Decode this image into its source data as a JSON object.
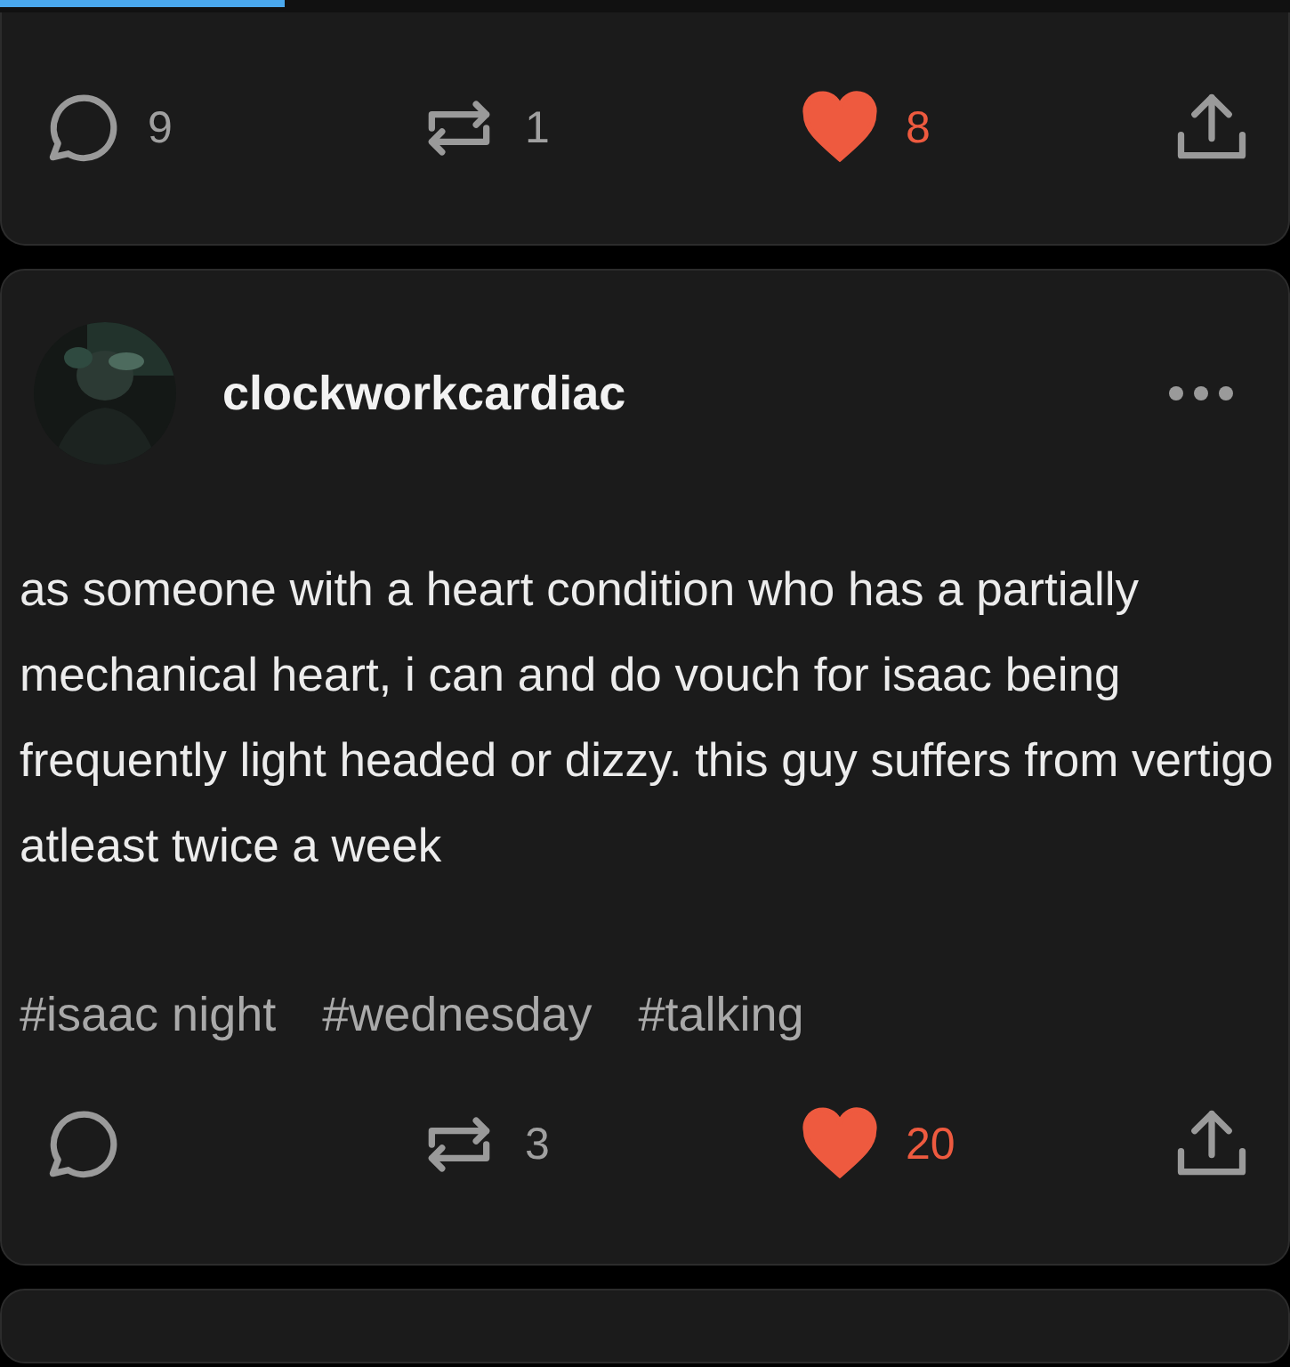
{
  "progress": {
    "level": 0.22
  },
  "posts": [
    {
      "actions": {
        "comments": "9",
        "reblogs": "1",
        "likes": "8",
        "liked": true
      }
    },
    {
      "author": "clockworkcardiac",
      "body": "as someone with a heart condition who has a partially mechanical heart, i can and do vouch for isaac being frequently light headed or dizzy. this guy suffers from vertigo atleast twice a week",
      "tags": [
        "#isaac night",
        "#wednesday",
        "#talking"
      ],
      "actions": {
        "reblogs": "3",
        "likes": "20",
        "liked": true
      }
    }
  ]
}
